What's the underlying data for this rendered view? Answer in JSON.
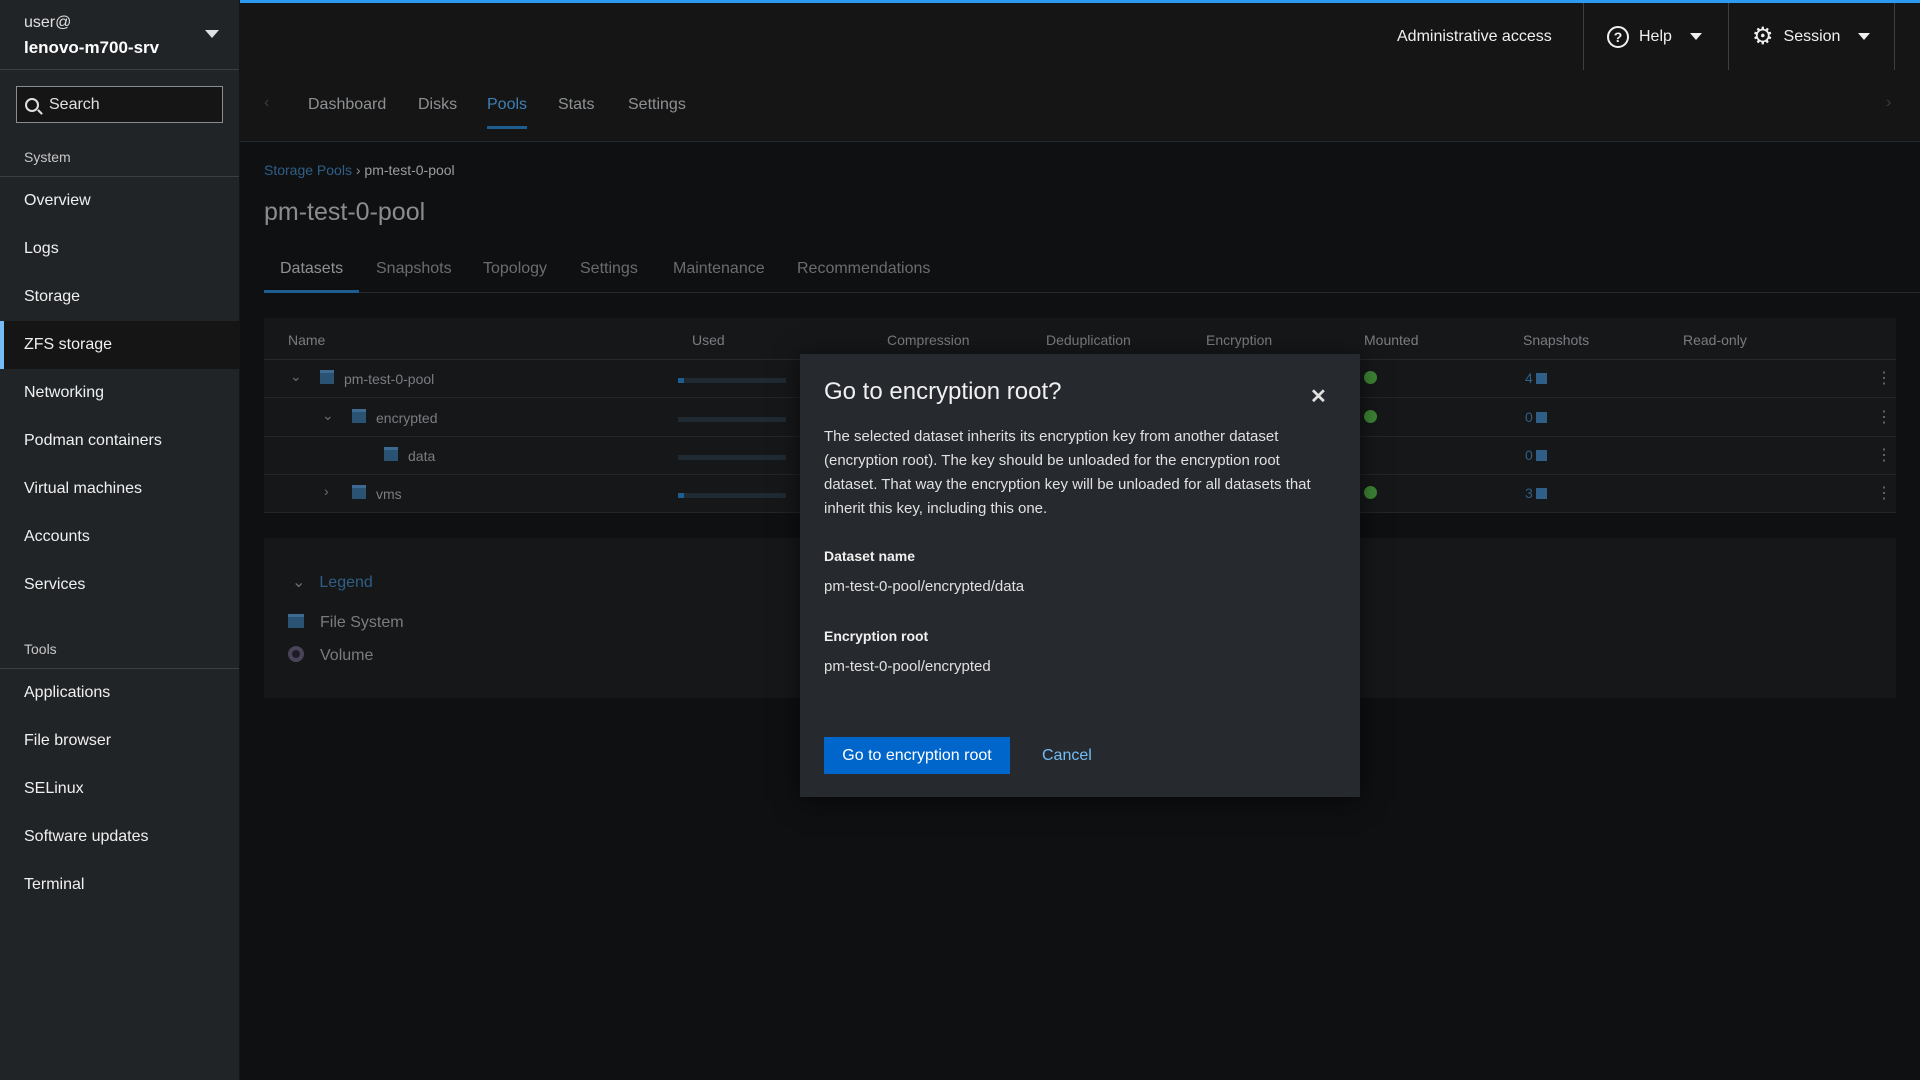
{
  "sidebar": {
    "user": "user@",
    "host": "lenovo-m700-srv",
    "search_placeholder": "Search",
    "system_label": "System",
    "system_items": [
      {
        "label": "Overview"
      },
      {
        "label": "Logs"
      },
      {
        "label": "Storage"
      },
      {
        "label": "ZFS storage"
      },
      {
        "label": "Networking"
      },
      {
        "label": "Podman containers"
      },
      {
        "label": "Virtual machines"
      },
      {
        "label": "Accounts"
      },
      {
        "label": "Services"
      }
    ],
    "active_item": "ZFS storage",
    "tools_label": "Tools",
    "tools_items": [
      {
        "label": "Applications"
      },
      {
        "label": "File browser"
      },
      {
        "label": "SELinux"
      },
      {
        "label": "Software updates"
      },
      {
        "label": "Terminal"
      }
    ]
  },
  "header": {
    "admin": "Administrative access",
    "help": "Help",
    "session": "Session",
    "accent": "#2b9af3"
  },
  "tabs": [
    {
      "label": "Dashboard"
    },
    {
      "label": "Disks"
    },
    {
      "label": "Pools"
    },
    {
      "label": "Stats"
    },
    {
      "label": "Settings"
    }
  ],
  "active_tab": "Pools",
  "breadcrumb": {
    "link": "Storage Pools",
    "current": "pm-test-0-pool"
  },
  "page_title": "pm-test-0-pool",
  "subtabs": [
    {
      "label": "Datasets"
    },
    {
      "label": "Snapshots"
    },
    {
      "label": "Topology"
    },
    {
      "label": "Settings"
    },
    {
      "label": "Maintenance"
    },
    {
      "label": "Recommendations"
    }
  ],
  "table": {
    "columns": [
      "Name",
      "Used",
      "Compression",
      "Deduplication",
      "Encryption",
      "Mounted",
      "Snapshots",
      "Read-only"
    ],
    "rows": [
      {
        "name": "pm-test-0-pool",
        "expanded": true,
        "mounted": true,
        "snapshots": "4"
      },
      {
        "name": "encrypted",
        "expanded": true,
        "mounted": true,
        "snapshots": "0"
      },
      {
        "name": "data",
        "expanded": null,
        "mounted": false,
        "snapshots": "0"
      },
      {
        "name": "vms",
        "expanded": false,
        "mounted": true,
        "snapshots": "3"
      }
    ]
  },
  "legend": {
    "title": "Legend",
    "items": [
      "File System",
      "Volume"
    ]
  },
  "modal": {
    "title": "Go to encryption root?",
    "body": "The selected dataset inherits its encryption key from another dataset (encryption root). The key should be unloaded for the encryption root dataset. That way the encryption key will be unloaded for all datasets that inherit this key, including this one.",
    "dataset_label": "Dataset name",
    "dataset_value": "pm-test-0-pool/encrypted/data",
    "root_label": "Encryption root",
    "root_value": "pm-test-0-pool/encrypted",
    "primary": "Go to encryption root",
    "cancel": "Cancel",
    "primary_color": "#0066cc"
  }
}
